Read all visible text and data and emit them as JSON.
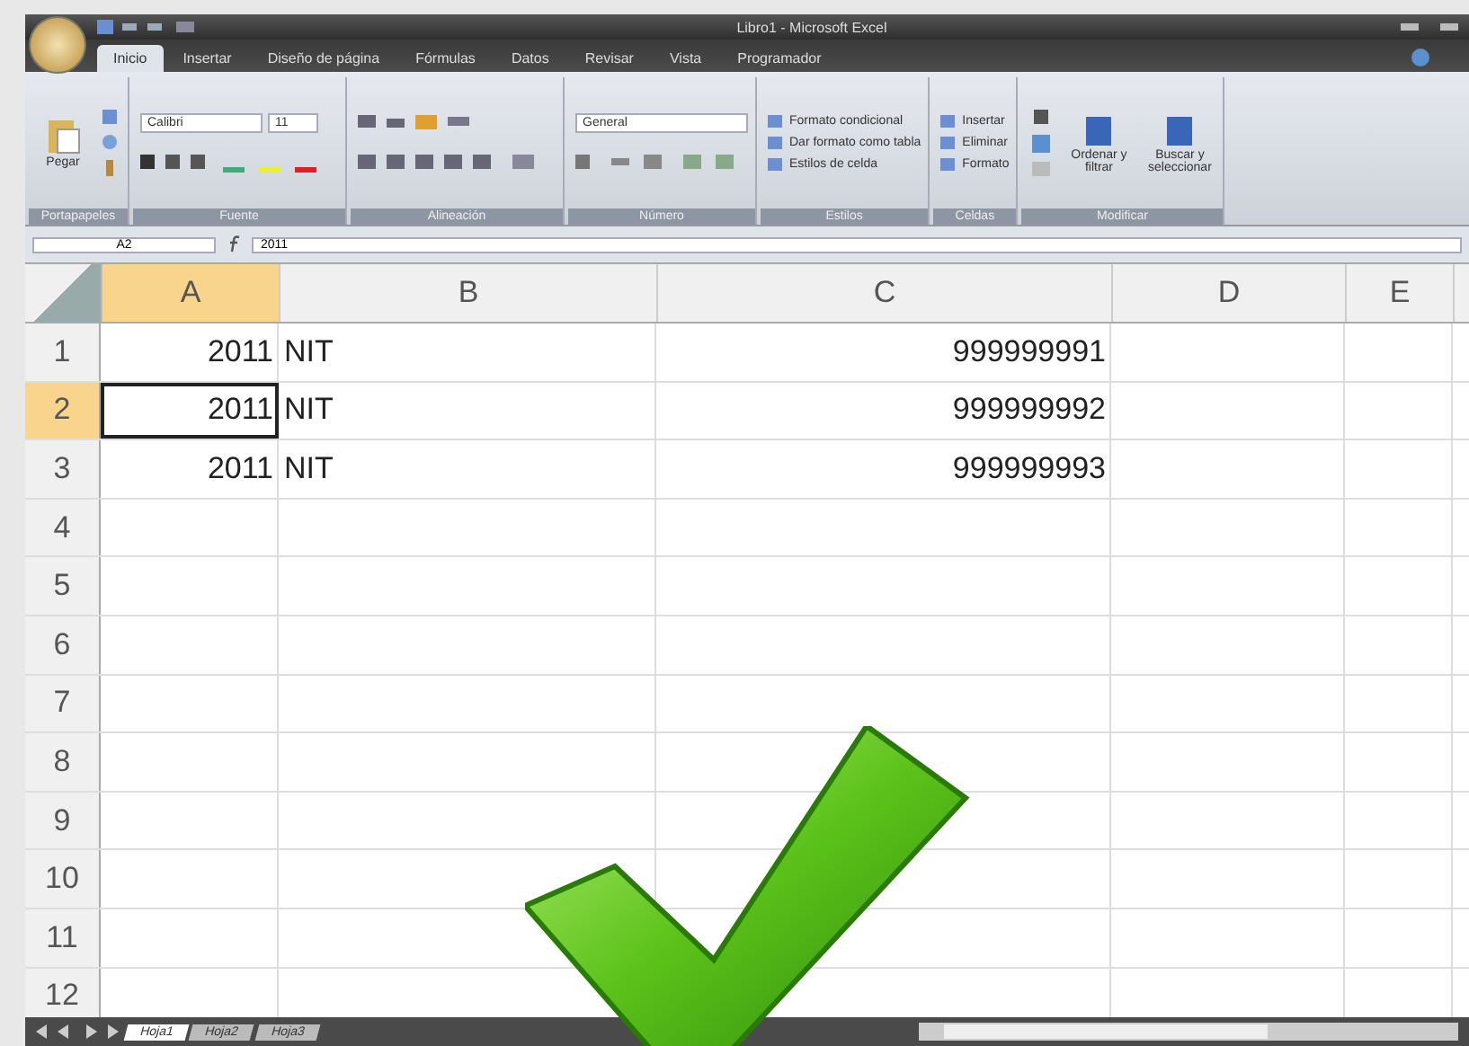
{
  "window": {
    "title": "Libro1 - Microsoft Excel"
  },
  "ribbon": {
    "tabs": [
      {
        "label": "Inicio",
        "selected": true
      },
      {
        "label": "Insertar",
        "selected": false
      },
      {
        "label": "Diseño de página",
        "selected": false
      },
      {
        "label": "Fórmulas",
        "selected": false
      },
      {
        "label": "Datos",
        "selected": false
      },
      {
        "label": "Revisar",
        "selected": false
      },
      {
        "label": "Vista",
        "selected": false
      },
      {
        "label": "Programador",
        "selected": false
      }
    ],
    "groups": [
      {
        "kind": "clipboard",
        "label": "Portapapeles",
        "items": [
          "Pegar"
        ]
      },
      {
        "kind": "font",
        "label": "Fuente",
        "items": [
          "Calibri",
          "11"
        ]
      },
      {
        "kind": "align",
        "label": "Alineación"
      },
      {
        "kind": "number",
        "label": "Número",
        "items": [
          "General"
        ]
      },
      {
        "kind": "list",
        "label": "Estilos",
        "items": [
          "Formato condicional",
          "Dar formato como tabla",
          "Estilos de celda"
        ]
      },
      {
        "kind": "list",
        "label": "Celdas",
        "items": [
          "Insertar",
          "Eliminar",
          "Formato"
        ]
      },
      {
        "kind": "big",
        "label": "Modificar",
        "items": [
          "Ordenar y filtrar",
          "Buscar y seleccionar"
        ]
      }
    ]
  },
  "formula_bar": {
    "name_box": "A2",
    "formula": "2011"
  },
  "sheet": {
    "columns": [
      {
        "label": "A",
        "kind": "number",
        "selected": true
      },
      {
        "label": "B",
        "kind": "text",
        "selected": false
      },
      {
        "label": "C",
        "kind": "number",
        "selected": false
      },
      {
        "label": "D",
        "selected": false
      },
      {
        "label": "E",
        "selected": false
      }
    ],
    "rows": [
      {
        "label": "1",
        "selected": false,
        "cells": [
          "2011",
          "NIT",
          "999999991"
        ]
      },
      {
        "label": "2",
        "selected": true,
        "cells": [
          "2011",
          "NIT",
          "999999992"
        ]
      },
      {
        "label": "3",
        "selected": false,
        "cells": [
          "2011",
          "NIT",
          "999999993"
        ]
      },
      {
        "label": "4",
        "selected": false
      },
      {
        "label": "5",
        "selected": false
      },
      {
        "label": "6",
        "selected": false
      },
      {
        "label": "7",
        "selected": false
      },
      {
        "label": "8",
        "selected": false
      },
      {
        "label": "9",
        "selected": false
      },
      {
        "label": "10",
        "selected": false
      },
      {
        "label": "11",
        "selected": false
      },
      {
        "label": "12",
        "selected": false
      }
    ]
  },
  "sheet_tabs": [
    {
      "label": "Hoja1",
      "selected": true
    },
    {
      "label": "Hoja2",
      "selected": false
    },
    {
      "label": "Hoja3",
      "selected": false
    }
  ]
}
